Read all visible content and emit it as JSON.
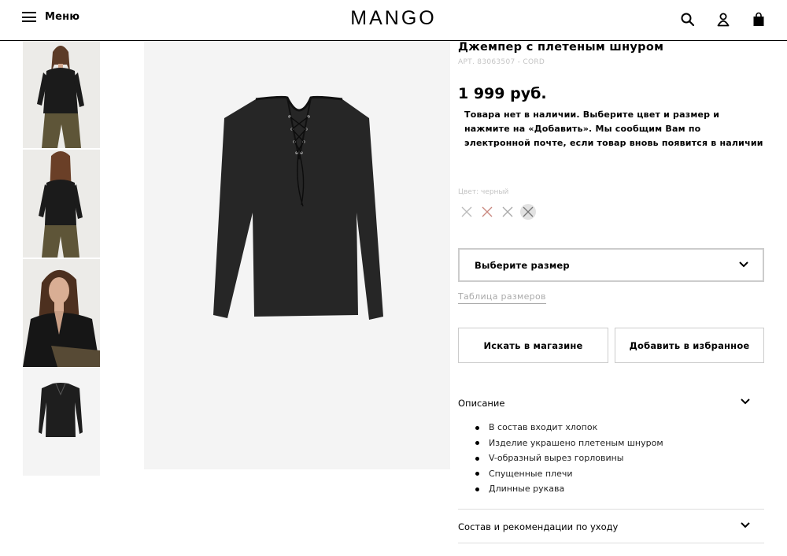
{
  "header": {
    "menu_label": "Меню",
    "logo": "MANGO",
    "icons": [
      "search-icon",
      "user-icon",
      "shopping-bag-icon"
    ]
  },
  "thumbnails": [
    {
      "name": "thumb-model-front"
    },
    {
      "name": "thumb-model-back"
    },
    {
      "name": "thumb-model-closeup"
    },
    {
      "name": "thumb-product"
    }
  ],
  "product": {
    "title": "Джемпер с плетеным шнуром",
    "article": "АРТ. 83063507 - CORD",
    "price": "1 999 руб.",
    "availability_notice": "Товара нет в наличии. Выберите цвет и размер и нажмите на «Добавить». Мы сообщим Вам по электронной почте, если товар вновь появится в наличии",
    "color_label": "Цвет: черный",
    "colors": [
      {
        "name": "grey",
        "hex": "#d8d8d8"
      },
      {
        "name": "red",
        "hex": "#e0b6b0"
      },
      {
        "name": "silver",
        "hex": "#dadada"
      },
      {
        "name": "black",
        "hex": "#cfcfcf",
        "selected": true
      }
    ]
  },
  "size": {
    "placeholder": "Выберите размер",
    "size_table_link": "Таблица размеров"
  },
  "actions": {
    "find_in_store": "Искать в магазине",
    "add_to_favorites": "Добавить в избранное"
  },
  "description": {
    "heading": "Описание",
    "items": [
      "В состав входит хлопок",
      "Изделие украшено плетеным шнуром",
      "V-образный вырез горловины",
      "Спущенные плечи",
      "Длинные рукава"
    ]
  },
  "composition": {
    "heading": "Состав и рекомендации по уходу"
  }
}
